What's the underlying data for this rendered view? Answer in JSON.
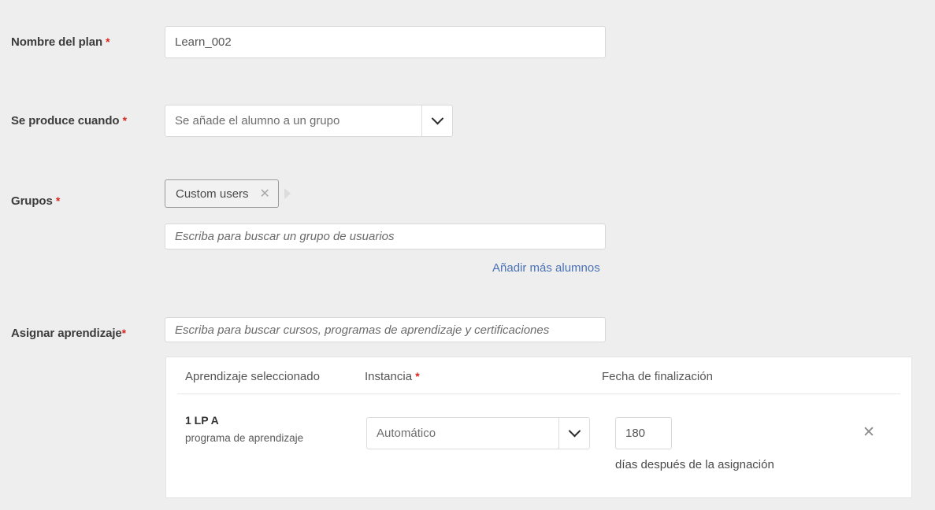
{
  "fields": {
    "plan_name": {
      "label": "Nombre del plan",
      "required_marker": "*",
      "value": "Learn_002"
    },
    "trigger": {
      "label": "Se produce cuando",
      "required_marker": "*",
      "selected": "Se añade el alumno a un grupo",
      "chevron_icon": "chevron-down-icon"
    },
    "groups": {
      "label": "Grupos",
      "required_marker": "*",
      "chips": [
        {
          "label": "Custom users",
          "remove_icon": "close-icon"
        }
      ],
      "overflow_icon": "caret-right-icon",
      "search_placeholder": "Escriba para buscar un grupo de usuarios",
      "add_more_link": "Añadir más alumnos"
    },
    "assign_learning": {
      "label": "Asignar aprendizaje",
      "required_marker": "*",
      "search_placeholder": "Escriba para buscar cursos, programas de aprendizaje y certificaciones"
    }
  },
  "learning_table": {
    "columns": {
      "learning": "Aprendizaje seleccionado",
      "instance": "Instancia",
      "instance_required_marker": "*",
      "completion_date": "Fecha de finalización"
    },
    "rows": [
      {
        "title": "1 LP A",
        "subtitle": "programa de aprendizaje",
        "instance_selected": "Automático",
        "instance_chevron_icon": "chevron-down-icon",
        "days_value": "180",
        "days_caption": "días después de la asignación",
        "remove_icon": "close-icon"
      }
    ]
  },
  "colors": {
    "page_background": "#eeeeee",
    "required_asterisk": "#d9251d",
    "link": "#4a72b5",
    "label_text": "#3c3c3c",
    "input_border": "#d8d8d8",
    "card_background": "#ffffff"
  }
}
